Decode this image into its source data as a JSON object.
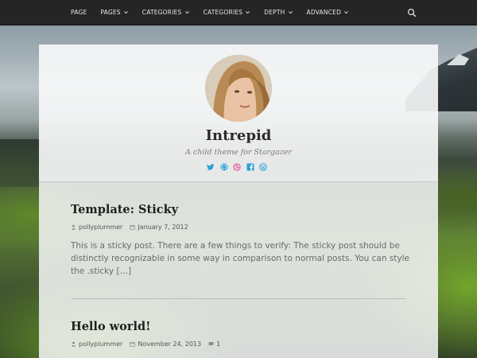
{
  "nav": {
    "items": [
      {
        "label": "PAGE",
        "dropdown": false
      },
      {
        "label": "PAGES",
        "dropdown": true
      },
      {
        "label": "CATEGORIES",
        "dropdown": true
      },
      {
        "label": "CATEGORIES",
        "dropdown": true
      },
      {
        "label": "DEPTH",
        "dropdown": true
      },
      {
        "label": "ADVANCED",
        "dropdown": true
      }
    ],
    "search_icon": "search-icon"
  },
  "site": {
    "title": "Intrepid",
    "description": "A child theme for Stargazer",
    "social": [
      "twitter-icon",
      "github-icon",
      "dribbble-icon",
      "facebook-icon",
      "wordpress-icon"
    ],
    "accent": "#2a9fd6"
  },
  "posts": [
    {
      "title": "Template: Sticky",
      "author": "pollyplummer",
      "date": "January 7, 2012",
      "excerpt": "This is a sticky post. There are a few things to verify: The sticky post should be distinctly recognizable in some way in comparison to normal posts. You can style the .sticky […]"
    },
    {
      "title": "Hello world!",
      "author": "pollyplummer",
      "date": "November 24, 2013",
      "comments": "1"
    }
  ]
}
